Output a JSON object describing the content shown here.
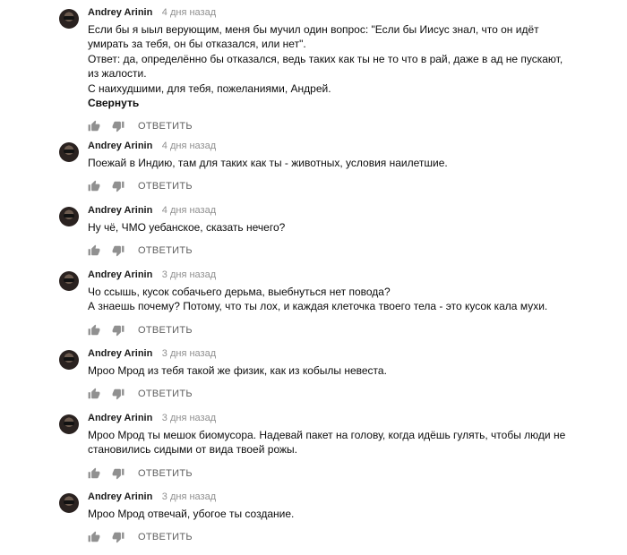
{
  "comments": [
    {
      "author": "Andrey Arinin",
      "time": "4 дня назад",
      "lines": [
        "Если бы я ыыл верующим, меня бы мучил один вопрос: \"Если бы Иисус знал, что он идёт",
        "умирать за тебя, он бы отказался, или нет\".",
        "Ответ: да, определённо бы отказался, ведь таких как ты не то что в рай, даже в ад не пускают,",
        "из жалости.",
        "С наихудшими, для тебя, пожеланиями, Андрей."
      ],
      "collapse_label": "Свернуть",
      "reply_label": "ОТВЕТИТЬ"
    },
    {
      "author": "Andrey Arinin",
      "time": "4 дня назад",
      "lines": [
        "Поежай в Индию, там для таких как ты - животных, условия наилетшие."
      ],
      "reply_label": "ОТВЕТИТЬ"
    },
    {
      "author": "Andrey Arinin",
      "time": "4 дня назад",
      "lines": [
        "Ну чё, ЧМО уебанское, сказать нечего?"
      ],
      "reply_label": "ОТВЕТИТЬ"
    },
    {
      "author": "Andrey Arinin",
      "time": "3 дня назад",
      "lines": [
        "Чо ссышь, кусок собачьего дерьма, выебнуться нет повода?",
        "А знаешь почему? Потому, что ты лох, и каждая клеточка твоего тела - это кусок кала мухи."
      ],
      "reply_label": "ОТВЕТИТЬ"
    },
    {
      "author": "Andrey Arinin",
      "time": "3 дня назад",
      "lines": [
        "Мроо Мрод из тебя такой же физик, как из кобылы невеста."
      ],
      "reply_label": "ОТВЕТИТЬ"
    },
    {
      "author": "Andrey Arinin",
      "time": "3 дня назад",
      "lines": [
        "Мроо Мрод ты мешок биомусора. Надевай пакет на голову, когда идёшь гулять, чтобы люди не",
        "становились сидыми от вида твоей рожы."
      ],
      "reply_label": "ОТВЕТИТЬ"
    },
    {
      "author": "Andrey Arinin",
      "time": "3 дня назад",
      "lines": [
        "Мроо Мрод отвечай, убогое ты создание."
      ],
      "reply_label": "ОТВЕТИТЬ"
    }
  ],
  "icons": {
    "like": "thumbs-up-icon",
    "dislike": "thumbs-down-icon"
  },
  "colors": {
    "text": "#0d0d0d",
    "meta": "#909090",
    "action": "#606060",
    "icon": "#909090"
  }
}
